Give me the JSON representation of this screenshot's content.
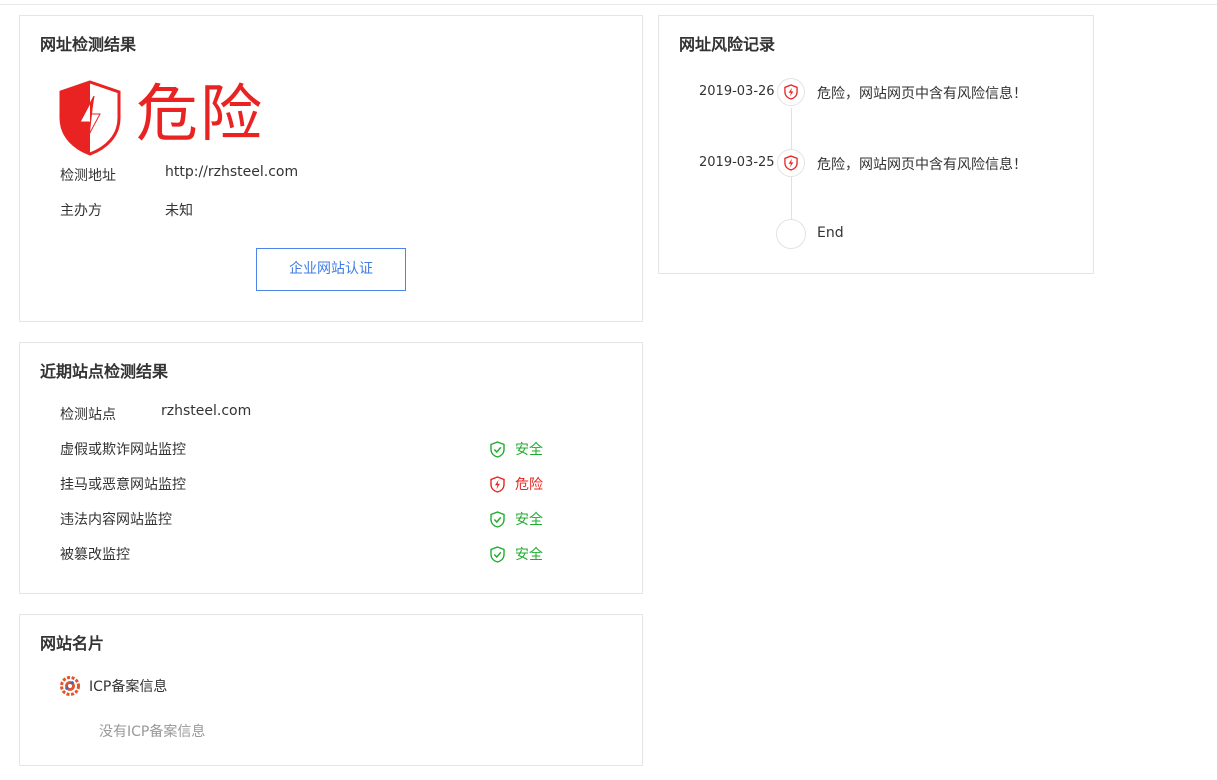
{
  "colors": {
    "danger": "#e92322",
    "safe": "#1fad2e",
    "accent": "#3f7de4"
  },
  "result": {
    "title": "网址检测结果",
    "verdict": "危险",
    "verdict_icon": "danger-shield-icon",
    "address_label": "检测地址",
    "address_value": "http://rzhsteel.com",
    "host_label": "主办方",
    "host_value": "未知",
    "cert_button": "企业网站认证"
  },
  "recent": {
    "title": "近期站点检测结果",
    "site_label": "检测站点",
    "site_value": "rzhsteel.com",
    "checks": [
      {
        "label": "虚假或欺诈网站监控",
        "status": "安全",
        "level": "safe"
      },
      {
        "label": "挂马或恶意网站监控",
        "status": "危险",
        "level": "danger"
      },
      {
        "label": "违法内容网站监控",
        "status": "安全",
        "level": "safe"
      },
      {
        "label": "被篡改监控",
        "status": "安全",
        "level": "safe"
      }
    ]
  },
  "profile": {
    "title": "网站名片",
    "icp_label": "ICP备案信息",
    "icp_empty": "没有ICP备案信息"
  },
  "history": {
    "title": "网址风险记录",
    "items": [
      {
        "date": "2019-03-26",
        "text": "危险，网站网页中含有风险信息！"
      },
      {
        "date": "2019-03-25",
        "text": "危险，网站网页中含有风险信息！"
      }
    ],
    "end_label": "End"
  }
}
